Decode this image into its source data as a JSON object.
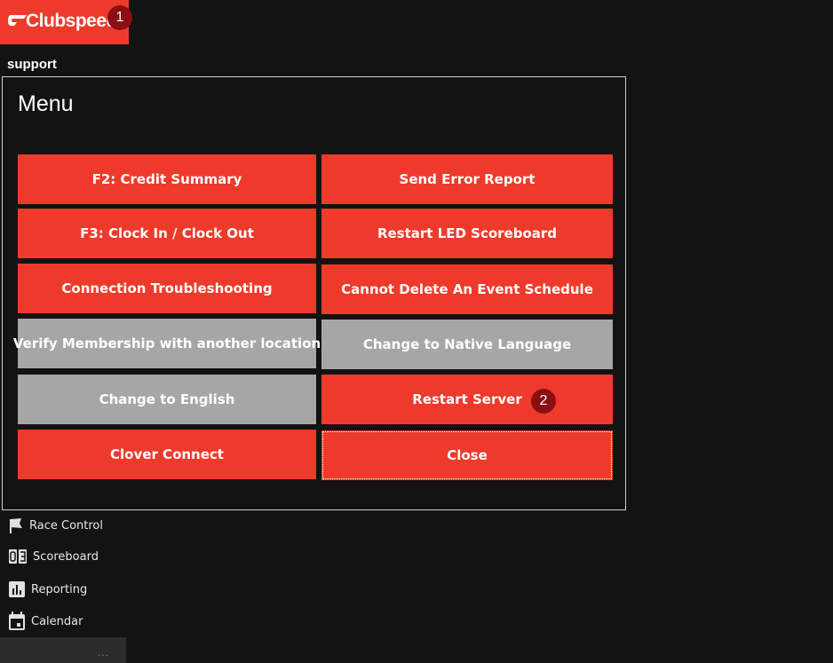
{
  "brand": {
    "name": "Clubspeed",
    "color": "#ee3a2b"
  },
  "markers": [
    "1",
    "2"
  ],
  "user": {
    "name": "support"
  },
  "menu": {
    "title": "Menu",
    "buttons": {
      "credit_summary": "F2: Credit Summary",
      "send_error_report": "Send Error Report",
      "clock_in_out": "F3: Clock In / Clock Out",
      "restart_led_scoreboard": "Restart LED Scoreboard",
      "connection_troubleshooting": "Connection Troubleshooting",
      "cannot_delete_event_schedule": "Cannot Delete An Event Schedule",
      "verify_membership": "Verify Membership with another location",
      "change_native_language": "Change to Native Language",
      "change_english": "Change to English",
      "restart_server": "Restart Server",
      "clover_connect": "Clover Connect",
      "close": "Close"
    },
    "colors": {
      "enabled": "#ee3a2b",
      "disabled": "#a6a6a6"
    }
  },
  "nav": {
    "items": [
      {
        "label": "Race Control",
        "icon": "flag-icon"
      },
      {
        "label": "Scoreboard",
        "icon": "scoreboard-icon"
      },
      {
        "label": "Reporting",
        "icon": "bar-chart-icon"
      },
      {
        "label": "Calendar",
        "icon": "calendar-icon"
      }
    ],
    "more": "..."
  }
}
